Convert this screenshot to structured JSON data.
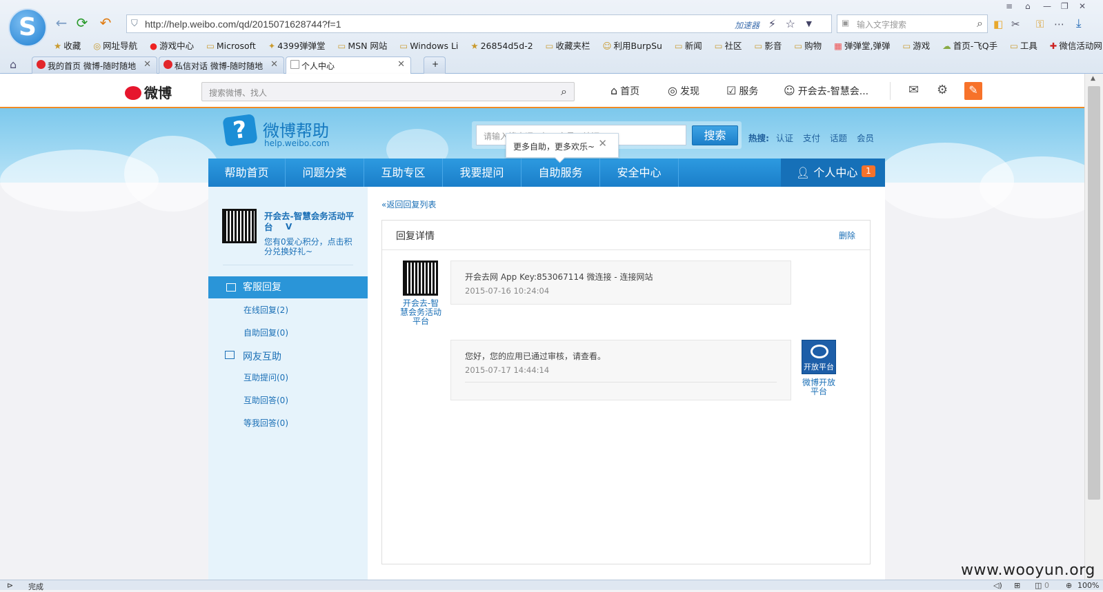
{
  "browser": {
    "logo_glyph": "S",
    "url": "http://help.weibo.com/qd/2015071628744?f=1",
    "accelerator": "加速器",
    "search_placeholder": "输入文字搜索",
    "bookmarks": [
      "收藏",
      "网址导航",
      "游戏中心",
      "Microsoft",
      "4399弹弹堂",
      "MSN 网站",
      "Windows Li",
      "26854d5d-2",
      "收藏夹栏",
      "利用BurpSu",
      "新闻",
      "社区",
      "影音",
      "购物",
      "弹弹堂,弹弹",
      "游戏",
      "首页-飞Q手",
      "工具",
      "微信活动网"
    ],
    "tabs": [
      {
        "title": "我的首页 微博-随时随地"
      },
      {
        "title": "私信对话 微博-随时随地"
      },
      {
        "title": "个人中心"
      }
    ],
    "new_tab": "+",
    "status": "完成",
    "zoom": "100%",
    "counter": "0"
  },
  "weibo": {
    "logo_text": "微博",
    "search_placeholder": "搜索微博、找人",
    "nav": {
      "home": "首页",
      "discover": "发现",
      "service": "服务",
      "user": "开会去-智慧会..."
    }
  },
  "help": {
    "logo_title": "微博帮助",
    "logo_url": "help.weibo.com",
    "search_placeholder": "请输入搜索词，如：交易、认证",
    "search_button": "搜索",
    "hot_label": "热搜:",
    "hot_items": [
      "认证",
      "支付",
      "话题",
      "会员"
    ],
    "tooltip": "更多自助，更多欢乐~",
    "nav": [
      "帮助首页",
      "问题分类",
      "互助专区",
      "我要提问",
      "自助服务",
      "安全中心"
    ],
    "user_center": "个人中心",
    "user_badge": "1"
  },
  "sidebar": {
    "profile_name": "开会去-智慧会务活动平台",
    "profile_points": "您有0爱心积分，点击积分兑换好礼~",
    "section1": "客服回复",
    "section1_items": [
      "在线回复(2)",
      "自助回复(0)"
    ],
    "section2": "网友互助",
    "section2_items": [
      "互助提问(0)",
      "互助回答(0)",
      "等我回答(0)"
    ]
  },
  "main": {
    "back_link": "«返回回复列表",
    "panel_title": "回复详情",
    "delete": "删除",
    "messages": [
      {
        "user": "开会去-智慧会务活动平台",
        "text": "开会去网 App Key:853067114 微连接 - 连接网站",
        "time": "2015-07-16 10:24:04"
      },
      {
        "user": "微博开放平台",
        "text": "您好，您的应用已通过审核，请查看。",
        "time": "2015-07-17 14:44:14",
        "badge": "开放平台"
      }
    ]
  },
  "watermark": "www.wooyun.org"
}
